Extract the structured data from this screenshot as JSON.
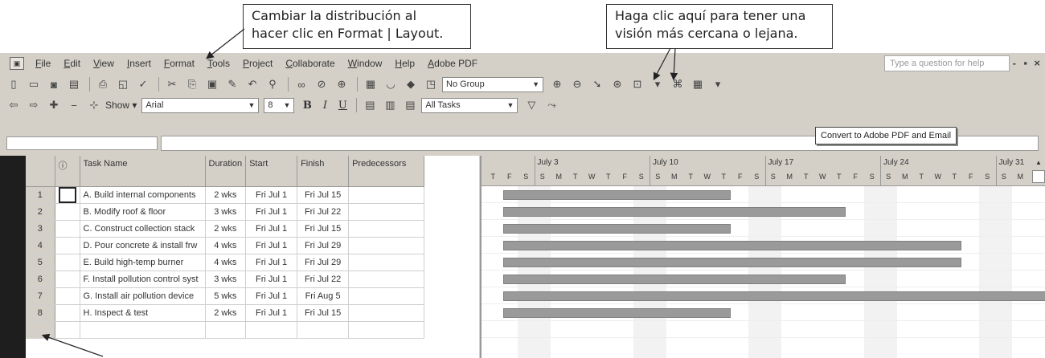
{
  "callouts": {
    "layout": {
      "line1": "Cambiar la distribución al",
      "line2": "hacer clic en Format | Layout."
    },
    "zoom": {
      "line1": "Haga clic aquí para tener una",
      "line2": "visión más cercana o lejana."
    }
  },
  "menu": {
    "items": [
      "File",
      "Edit",
      "View",
      "Insert",
      "Format",
      "Tools",
      "Project",
      "Collaborate",
      "Window",
      "Help",
      "Adobe PDF"
    ],
    "help_placeholder": "Type a question for help",
    "restore": "-",
    "maximize": "▪",
    "close": "×"
  },
  "toolbar1": {
    "icons": [
      "new-icon",
      "open-icon",
      "save-icon",
      "publish-icon",
      "print-icon",
      "print-preview-icon",
      "spelling-icon",
      "cut-icon",
      "copy-icon",
      "paste-icon",
      "format-painter-icon",
      "undo-icon",
      "insert-hyperlink-icon",
      "link-tasks-icon",
      "unlink-tasks-icon",
      "split-task-icon",
      "task-info-icon",
      "task-notes-icon",
      "assign-resources-icon",
      "publish-web-icon"
    ],
    "group_value": "No Group",
    "zoom_in": "⊕",
    "zoom_out": "⊖",
    "scroll_to_task": "➘",
    "extra_icons": [
      "⊛",
      "⊡",
      "▾",
      "⌘",
      "▦",
      "▾"
    ]
  },
  "toolbar2": {
    "show_label": "Show",
    "font_value": "Arial",
    "size_value": "8",
    "bold": "B",
    "italic": "I",
    "underline": "U",
    "filter_value": "All Tasks",
    "autofilter": "▽",
    "gantt_wizard": "⤳"
  },
  "tooltip": "Convert to Adobe PDF and Email",
  "table": {
    "headers": {
      "indicator": "ⓘ",
      "name": "Task Name",
      "duration": "Duration",
      "start": "Start",
      "finish": "Finish",
      "pred": "Predecessors"
    },
    "rows": [
      {
        "id": "1",
        "name": "A. Build internal components",
        "duration": "2 wks",
        "start": "Fri Jul 1",
        "finish": "Fri Jul 15"
      },
      {
        "id": "2",
        "name": "B. Modify roof & floor",
        "duration": "3 wks",
        "start": "Fri Jul 1",
        "finish": "Fri Jul 22"
      },
      {
        "id": "3",
        "name": "C. Construct collection stack",
        "duration": "2 wks",
        "start": "Fri Jul 1",
        "finish": "Fri Jul 15"
      },
      {
        "id": "4",
        "name": "D. Pour concrete & install frw",
        "duration": "4 wks",
        "start": "Fri Jul 1",
        "finish": "Fri Jul 29"
      },
      {
        "id": "5",
        "name": "E. Build high-temp burner",
        "duration": "4 wks",
        "start": "Fri Jul 1",
        "finish": "Fri Jul 29"
      },
      {
        "id": "6",
        "name": "F. Install pollution control syst",
        "duration": "3 wks",
        "start": "Fri Jul 1",
        "finish": "Fri Jul 22"
      },
      {
        "id": "7",
        "name": "G. Install air pollution device",
        "duration": "5 wks",
        "start": "Fri Jul 1",
        "finish": "Fri Aug 5"
      },
      {
        "id": "8",
        "name": "H. Inspect & test",
        "duration": "2 wks",
        "start": "Fri Jul 1",
        "finish": "Fri Jul 15"
      }
    ]
  },
  "gantt": {
    "weeks": [
      "July 3",
      "July 10",
      "July 17",
      "July 24",
      "July 31"
    ],
    "days": [
      "T",
      "F",
      "S",
      "S",
      "M",
      "T",
      "W",
      "T",
      "F",
      "S",
      "S",
      "M",
      "T",
      "W",
      "T",
      "F",
      "S",
      "S",
      "M",
      "T",
      "W",
      "T",
      "F",
      "S",
      "S",
      "M",
      "T",
      "W",
      "T",
      "F",
      "S",
      "S",
      "M"
    ],
    "first_day": "2005-06-30",
    "task_start": "2005-07-01",
    "durations_days": [
      14,
      21,
      14,
      28,
      28,
      21,
      35,
      14
    ],
    "scroll_up": "▲"
  }
}
